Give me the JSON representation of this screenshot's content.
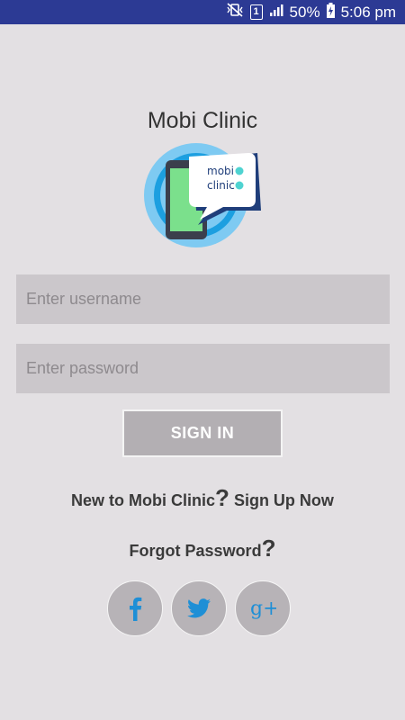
{
  "status_bar": {
    "battery": "50%",
    "time": "5:06 pm",
    "sim_slot": "1"
  },
  "app": {
    "title": "Mobi Clinic",
    "logo_text_line1": "mobi",
    "logo_text_line2": "clinic"
  },
  "login": {
    "username_placeholder": "Enter username",
    "password_placeholder": "Enter password",
    "signin_label": "SIGN IN",
    "signup_prefix": "New to Mobi Clinic",
    "signup_qmark": "?",
    "signup_link": " Sign Up Now",
    "forgot_label": "Forgot Password",
    "forgot_qmark": "?"
  },
  "social": {
    "facebook_icon": "facebook-icon",
    "twitter_icon": "twitter-icon",
    "google_plus_icon": "google-plus-icon",
    "google_plus_glyph": "g+",
    "brand_color": "#1e8fd6"
  },
  "colors": {
    "status_bar": "#2c3a94",
    "background": "#e3e0e3",
    "field": "#cbc7cb",
    "button": "#b3afb3"
  }
}
